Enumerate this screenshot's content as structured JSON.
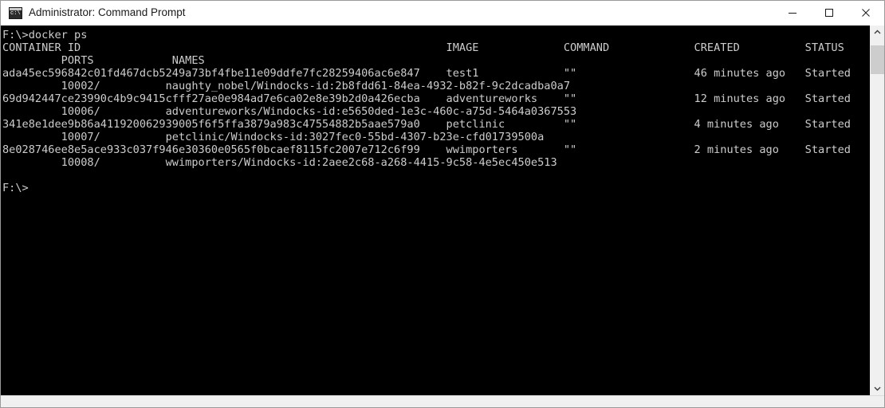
{
  "window": {
    "title": "Administrator: Command Prompt",
    "icon": "cmd-icon",
    "icon_glyph": "c:\\",
    "controls": {
      "minimize": "minimize-button",
      "maximize": "maximize-button",
      "close": "close-button"
    }
  },
  "console": {
    "background": "#000000",
    "foreground": "#cccccc",
    "lines": [
      "F:\\>docker ps",
      "CONTAINER ID                                                        IMAGE             COMMAND             CREATED          STATUS",
      "         PORTS            NAMES",
      "ada45ec596842c01fd467dcb5249a73bf4fbe11e09ddfe7fc28259406ac6e847    test1             \"\"                  46 minutes ago   Started",
      "         10002/          naughty_nobel/Windocks-id:2b8fdd61-84ea-4932-b82f-9c2dcadba0a7",
      "69d942447ce23990c4b9c9415cfff27ae0e984ad7e6ca02e8e39b2d0a426ecba    adventureworks    \"\"                  12 minutes ago   Started",
      "         10006/          adventureworks/Windocks-id:e5650ded-1e3c-460c-a75d-5464a0367553",
      "341e8e1dee9b86a411920062939005f6f5ffa3879a983c47554882b5aae579a0    petclinic         \"\"                  4 minutes ago    Started",
      "         10007/          petclinic/Windocks-id:3027fec0-55bd-4307-b23e-cfd01739500a",
      "8e028746ee8e5ace933c037f946e30360e0565f0bcaef8115fc2007e712c6f99    wwimporters       \"\"                  2 minutes ago    Started",
      "         10008/          wwimporters/Windocks-id:2aee2c68-a268-4415-9c58-4e5ec450e513",
      "",
      "F:\\>"
    ],
    "command": "docker ps",
    "prompt": "F:\\>",
    "columns": [
      "CONTAINER ID",
      "IMAGE",
      "COMMAND",
      "CREATED",
      "STATUS",
      "PORTS",
      "NAMES"
    ],
    "rows": [
      {
        "container_id": "ada45ec596842c01fd467dcb5249a73bf4fbe11e09ddfe7fc28259406ac6e847",
        "image": "test1",
        "command": "\"\"",
        "created": "46 minutes ago",
        "status": "Started",
        "ports": "10002/",
        "names": "naughty_nobel/Windocks-id:2b8fdd61-84ea-4932-b82f-9c2dcadba0a7"
      },
      {
        "container_id": "69d942447ce23990c4b9c9415cfff27ae0e984ad7e6ca02e8e39b2d0a426ecba",
        "image": "adventureworks",
        "command": "\"\"",
        "created": "12 minutes ago",
        "status": "Started",
        "ports": "10006/",
        "names": "adventureworks/Windocks-id:e5650ded-1e3c-460c-a75d-5464a0367553"
      },
      {
        "container_id": "341e8e1dee9b86a411920062939005f6f5ffa3879a983c47554882b5aae579a0",
        "image": "petclinic",
        "command": "\"\"",
        "created": "4 minutes ago",
        "status": "Started",
        "ports": "10007/",
        "names": "petclinic/Windocks-id:3027fec0-55bd-4307-b23e-cfd01739500a"
      },
      {
        "container_id": "8e028746ee8e5ace933c037f946e30360e0565f0bcaef8115fc2007e712c6f99",
        "image": "wwimporters",
        "command": "\"\"",
        "created": "2 minutes ago",
        "status": "Started",
        "ports": "10008/",
        "names": "wwimporters/Windocks-id:2aee2c68-a268-4415-9c58-4e5ec450e513"
      }
    ]
  },
  "scrollbar": {
    "up_arrow": "scroll-up-arrow",
    "down_arrow": "scroll-down-arrow",
    "thumb": "scroll-thumb"
  }
}
